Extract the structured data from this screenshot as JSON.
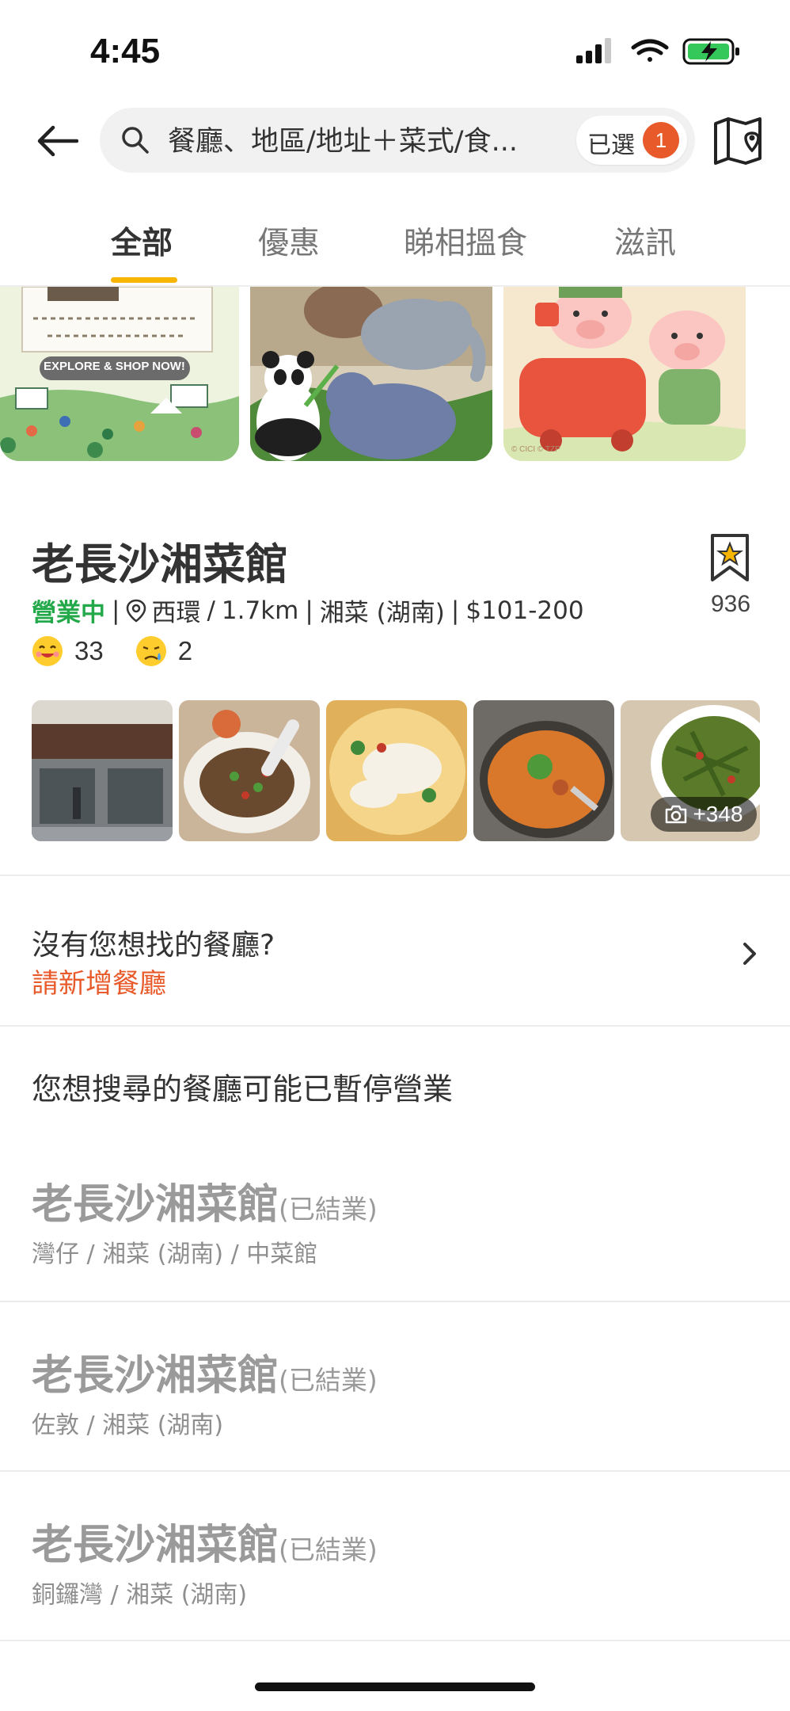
{
  "status_bar": {
    "time": "4:45"
  },
  "search": {
    "query": "餐廳、地區/地址＋菜式/食...",
    "selected_label": "已選",
    "selected_count": "1"
  },
  "tabs": [
    {
      "label": "全部",
      "active": true
    },
    {
      "label": "優惠",
      "active": false
    },
    {
      "label": "睇相搵食",
      "active": false
    },
    {
      "label": "滋訊",
      "active": false
    }
  ],
  "banners": {
    "banner1_text": "EXPLORE & SHOP NOW!",
    "banner3_copyright": "© CICI © TZP"
  },
  "restaurant": {
    "name": "老長沙湘菜館",
    "status": "營業中",
    "district": "西環",
    "distance": "1.7km",
    "cuisine": "湘菜 (湖南)",
    "price": "$101-200",
    "smile_count": "33",
    "cry_count": "2",
    "bookmark_count": "936",
    "more_photos": "+348"
  },
  "not_found": {
    "question": "沒有您想找的餐廳?",
    "link": "請新增餐廳"
  },
  "closed": {
    "heading": "您想搜尋的餐廳可能已暫停營業",
    "items": [
      {
        "name": "老長沙湘菜館",
        "tag": "(已結業)",
        "sub": "灣仔 / 湘菜 (湖南) / 中菜館"
      },
      {
        "name": "老長沙湘菜館",
        "tag": "(已結業)",
        "sub": "佐敦 / 湘菜 (湖南)"
      },
      {
        "name": "老長沙湘菜館",
        "tag": "(已結業)",
        "sub": "銅鑼灣 / 湘菜 (湖南)"
      }
    ]
  },
  "colors": {
    "accent": "#f7b500",
    "open_green": "#23a94a",
    "link_orange": "#e85a2a"
  }
}
